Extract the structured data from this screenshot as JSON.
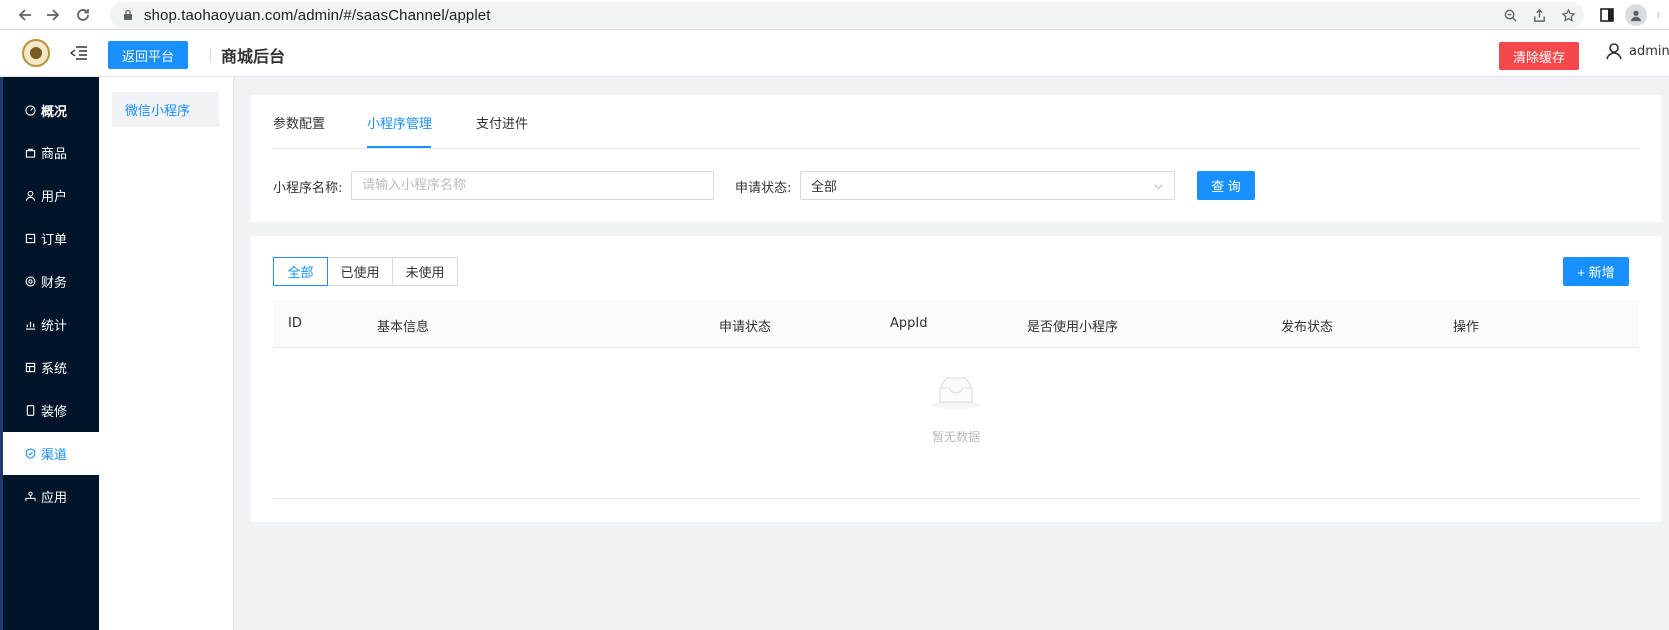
{
  "browser": {
    "url": "shop.taohaoyuan.com/admin/#/saasChannel/applet"
  },
  "header": {
    "back_label": "返回平台",
    "shop_title": "商城后台",
    "clear_cache_label": "清除缓存",
    "user_name": "admin"
  },
  "sidebar": {
    "items": [
      {
        "label": "概况",
        "icon": "dashboard-icon"
      },
      {
        "label": "商品",
        "icon": "bag-icon"
      },
      {
        "label": "用户",
        "icon": "user-icon"
      },
      {
        "label": "订单",
        "icon": "order-icon"
      },
      {
        "label": "财务",
        "icon": "finance-icon"
      },
      {
        "label": "统计",
        "icon": "stats-icon"
      },
      {
        "label": "系统",
        "icon": "system-icon"
      },
      {
        "label": "装修",
        "icon": "mobile-icon"
      },
      {
        "label": "渠道",
        "icon": "shield-icon"
      },
      {
        "label": "应用",
        "icon": "apps-icon"
      }
    ],
    "active_index": 8
  },
  "sub_sidebar": {
    "items": [
      {
        "label": "微信小程序"
      }
    ]
  },
  "tabs": {
    "items": [
      {
        "label": "参数配置"
      },
      {
        "label": "小程序管理"
      },
      {
        "label": "支付进件"
      }
    ],
    "active_index": 1
  },
  "filter": {
    "name_label": "小程序名称:",
    "name_placeholder": "请输入小程序名称",
    "name_value": "",
    "status_label": "申请状态:",
    "status_value": "全部",
    "query_label": "查 询"
  },
  "list": {
    "radio_items": [
      {
        "label": "全部"
      },
      {
        "label": "已使用"
      },
      {
        "label": "未使用"
      }
    ],
    "radio_active_index": 0,
    "add_label": "+ 新增",
    "columns": [
      "ID",
      "基本信息",
      "申请状态",
      "AppId",
      "是否使用小程序",
      "发布状态",
      "操作"
    ],
    "empty_text": "暂无数据"
  },
  "colors": {
    "primary": "#1890ff",
    "danger": "#f5484a",
    "sidebar_bg": "#001529"
  }
}
